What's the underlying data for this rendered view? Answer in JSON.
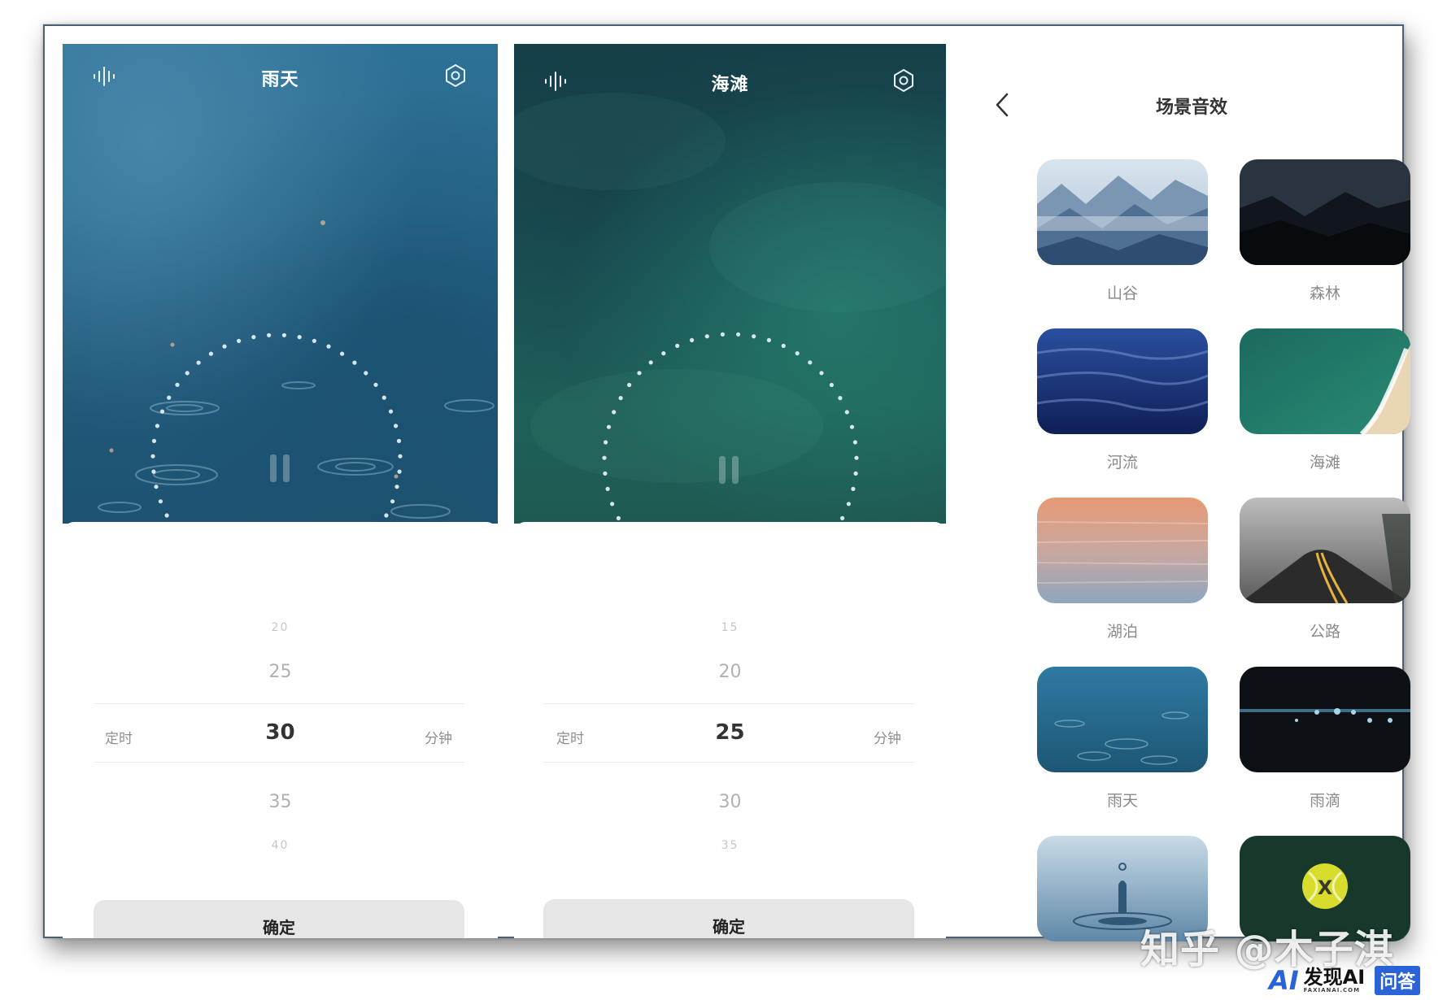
{
  "panels": [
    {
      "title": "雨天",
      "picker": {
        "far_top": "20",
        "near_top": "25",
        "selected": "30",
        "near_bottom": "35",
        "far_bottom": "40"
      },
      "left_label": "定时",
      "right_label": "分钟",
      "confirm": "确定"
    },
    {
      "title": "海滩",
      "picker": {
        "far_top": "15",
        "near_top": "20",
        "selected": "25",
        "near_bottom": "30",
        "far_bottom": "35"
      },
      "left_label": "定时",
      "right_label": "分钟",
      "confirm": "确定"
    }
  ],
  "scene": {
    "title": "场景音效",
    "items": [
      {
        "label": "山谷"
      },
      {
        "label": "森林"
      },
      {
        "label": "河流"
      },
      {
        "label": "海滩"
      },
      {
        "label": "湖泊"
      },
      {
        "label": "公路"
      },
      {
        "label": "雨天"
      },
      {
        "label": "雨滴"
      },
      {
        "label": ""
      },
      {
        "label": ""
      }
    ]
  },
  "watermark": "知乎 @木子淇",
  "brand": {
    "logo": "AI",
    "name": "发现AI",
    "sub": "FAXIANAI.COM",
    "badge": "问答"
  },
  "icons": {
    "wave": "sound-wave-icon",
    "settings": "settings-icon",
    "pause": "pause-icon",
    "back": "back-chevron-icon"
  },
  "colors": {
    "accent_text": "#333333",
    "muted": "#8a8a8a",
    "button_bg": "#e6e6e6"
  }
}
